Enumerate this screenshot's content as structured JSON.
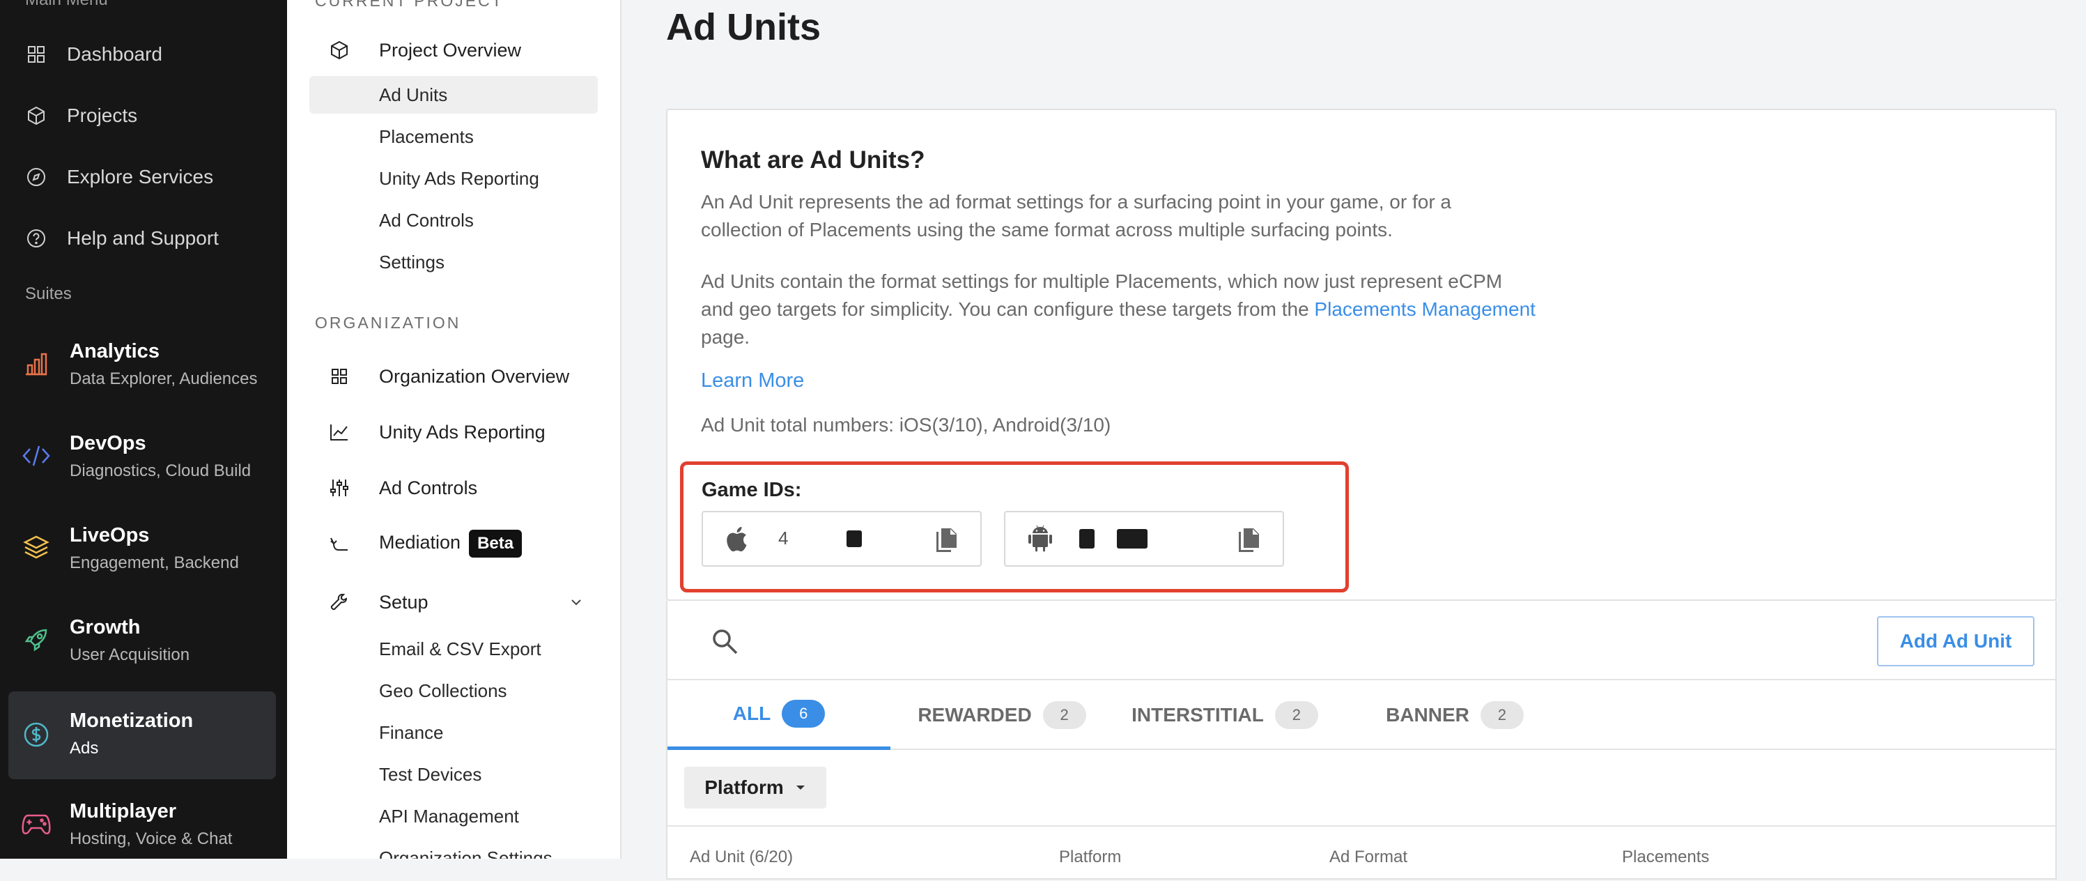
{
  "sidebar": {
    "clipped_heading": "Main Menu",
    "items": [
      {
        "label": "Dashboard",
        "icon": "grid-icon"
      },
      {
        "label": "Projects",
        "icon": "cube-icon"
      },
      {
        "label": "Explore Services",
        "icon": "compass-icon"
      },
      {
        "label": "Help and Support",
        "icon": "help-icon"
      }
    ],
    "suites_heading": "Suites",
    "suites": [
      {
        "title": "Analytics",
        "subtitle": "Data Explorer, Audiences",
        "icon": "bar-chart-icon",
        "color": "#e8734a"
      },
      {
        "title": "DevOps",
        "subtitle": "Diagnostics, Cloud Build",
        "icon": "code-icon",
        "color": "#5b7cf0"
      },
      {
        "title": "LiveOps",
        "subtitle": "Engagement, Backend",
        "icon": "layers-icon",
        "color": "#f2c14e"
      },
      {
        "title": "Growth",
        "subtitle": "User Acquisition",
        "icon": "rocket-icon",
        "color": "#4fc08d"
      },
      {
        "title": "Monetization",
        "subtitle": "Ads",
        "icon": "dollar-icon",
        "color": "#4fb8c9",
        "active": true
      },
      {
        "title": "Multiplayer",
        "subtitle": "Hosting, Voice & Chat",
        "icon": "gamepad-icon",
        "color": "#e85d8a"
      }
    ]
  },
  "subnav": {
    "current_project_heading": "CURRENT PROJECT",
    "project_overview": "Project Overview",
    "project_items": [
      "Ad Units",
      "Placements",
      "Unity Ads Reporting",
      "Ad Controls",
      "Settings"
    ],
    "organization_heading": "ORGANIZATION",
    "org_items": [
      {
        "label": "Organization Overview",
        "icon": "grid-icon"
      },
      {
        "label": "Unity Ads Reporting",
        "icon": "line-chart-icon"
      },
      {
        "label": "Ad Controls",
        "icon": "sliders-icon"
      },
      {
        "label": "Mediation",
        "icon": "mediation-icon"
      },
      {
        "label": "Setup",
        "icon": "wrench-icon"
      }
    ],
    "mediation_badge": "Beta",
    "setup_items": [
      "Email & CSV Export",
      "Geo Collections",
      "Finance",
      "Test Devices",
      "API Management",
      "Organization Settings"
    ]
  },
  "main": {
    "title": "Ad Units",
    "info": {
      "heading": "What are Ad Units?",
      "para1_line1": "An Ad Unit represents the ad format settings for a surfacing point in your game, or for a",
      "para1_line2": "collection of Placements using the same format across multiple surfacing points.",
      "para2_line1": "Ad Units contain the format settings for multiple Placements, which now just represent eCPM",
      "para2_line2_prefix": "and geo targets for simplicity. You can configure these targets from the",
      "para2_link": "Placements Management",
      "para2_line3": "page.",
      "learn_more": "Learn More",
      "totals": "Ad Unit total numbers: iOS(3/10), Android(3/10)"
    },
    "game_ids": {
      "label": "Game IDs:",
      "ios": {
        "platform": "apple-icon",
        "value": "4"
      },
      "android": {
        "platform": "android-icon",
        "value": ""
      }
    },
    "add_button": "Add Ad Unit",
    "tabs": [
      {
        "label": "ALL",
        "count": "6",
        "active": true
      },
      {
        "label": "REWARDED",
        "count": "2"
      },
      {
        "label": "INTERSTITIAL",
        "count": "2"
      },
      {
        "label": "BANNER",
        "count": "2"
      }
    ],
    "platform_filter": "Platform",
    "table_headers": [
      "Ad Unit (6/20)",
      "Platform",
      "Ad Format",
      "Placements"
    ]
  },
  "colors": {
    "accent": "#3a8ee6",
    "highlight_border": "#e2402f",
    "sidebar_bg": "#161616"
  }
}
